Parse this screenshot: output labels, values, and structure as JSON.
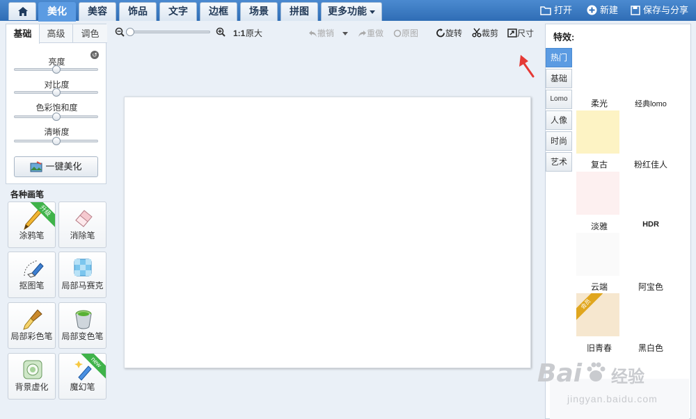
{
  "topbar": {
    "tabs": [
      {
        "label": "美化",
        "active": true
      },
      {
        "label": "美容"
      },
      {
        "label": "饰品"
      },
      {
        "label": "文字"
      },
      {
        "label": "边框"
      },
      {
        "label": "场景"
      },
      {
        "label": "拼图"
      },
      {
        "label": "更多功能"
      }
    ],
    "actions": {
      "open": "打开",
      "new": "新建",
      "save_share": "保存与分享"
    }
  },
  "left_panel": {
    "tabs": [
      "基础",
      "高级",
      "调色"
    ],
    "sliders": [
      {
        "label": "亮度",
        "value": 0.5
      },
      {
        "label": "对比度",
        "value": 0.5
      },
      {
        "label": "色彩饱和度",
        "value": 0.5
      },
      {
        "label": "清晰度",
        "value": 0.5
      }
    ],
    "beautify_label": "一键美化"
  },
  "brushes": {
    "title": "各种画笔",
    "items": [
      {
        "label": "涂鸦笔",
        "icon": "pencil-icon",
        "badge": "升级"
      },
      {
        "label": "消除笔",
        "icon": "eraser-icon"
      },
      {
        "label": "抠图笔",
        "icon": "cutout-pen-icon"
      },
      {
        "label": "局部马赛克",
        "icon": "mosaic-icon"
      },
      {
        "label": "局部彩色笔",
        "icon": "paint-brush-icon"
      },
      {
        "label": "局部变色笔",
        "icon": "color-bucket-icon"
      },
      {
        "label": "背景虚化",
        "icon": "blur-background-icon"
      },
      {
        "label": "魔幻笔",
        "icon": "magic-pen-icon",
        "badge": "new"
      }
    ]
  },
  "toolbar": {
    "zoom_level": 0,
    "ratio_label": "1:1",
    "original_size": "原大",
    "undo": "撤销",
    "redo": "重做",
    "original": "原图",
    "rotate": "旋转",
    "crop": "裁剪",
    "resize": "尺寸"
  },
  "effects": {
    "title": "特效:",
    "categories": [
      "热门",
      "基础",
      "Lomo",
      "人像",
      "时尚",
      "艺术"
    ],
    "items": [
      {
        "label": "柔光",
        "color": "#fdf3c4"
      },
      {
        "label": "经典lomo"
      },
      {
        "label": "复古",
        "color": "#fdf0f0"
      },
      {
        "label": "粉红佳人"
      },
      {
        "label": "淡雅",
        "color": "#fafafa"
      },
      {
        "label": "HDR"
      },
      {
        "label": "云端",
        "color": "#f6e7cf",
        "badge": "会员"
      },
      {
        "label": "阿宝色"
      },
      {
        "label": "旧青春"
      },
      {
        "label": "黑白色"
      }
    ]
  },
  "watermark": {
    "brand": "Bai",
    "brand_cn": "经验",
    "url": "jingyan.baidu.com"
  },
  "colors": {
    "accent": "#5b9be2",
    "topbar": "#3a7bc4",
    "arrow": "#e53935"
  }
}
